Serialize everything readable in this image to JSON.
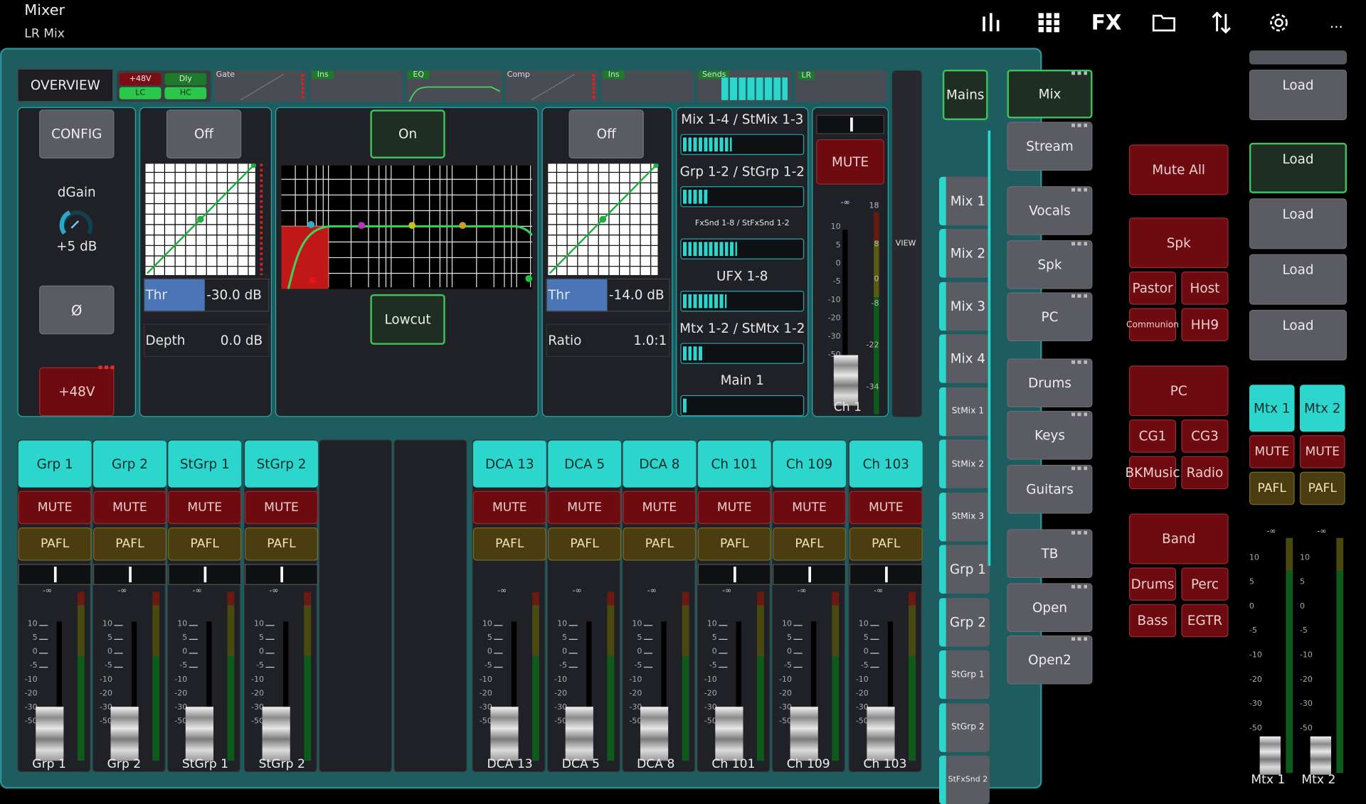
{
  "app": {
    "title": "Mixer",
    "subtitle": "LR Mix"
  },
  "toolbar": {
    "icons": [
      "meters-icon",
      "grid-icon",
      "fx-icon",
      "folder-icon",
      "transfer-icon",
      "settings-icon",
      "more-icon"
    ],
    "fx_label": "FX",
    "more_label": "..."
  },
  "overview": {
    "tab_label": "OVERVIEW",
    "badges": [
      "+48V",
      "Dly",
      "LC",
      "HC"
    ],
    "strip": [
      "Gate",
      "Ins",
      "EQ",
      "Comp",
      "Ins",
      "Sends",
      "LR"
    ]
  },
  "config": {
    "button": "CONFIG",
    "dgain_label": "dGain",
    "dgain_value": "+5 dB",
    "phase_label": "Ø",
    "phantom_label": "+48V"
  },
  "gate": {
    "state": "Off",
    "thr_label": "Thr",
    "thr_value": "-30.0 dB",
    "depth_label": "Depth",
    "depth_value": "0.0 dB"
  },
  "eq": {
    "state": "On",
    "lowcut_label": "Lowcut"
  },
  "comp": {
    "state": "Off",
    "thr_label": "Thr",
    "thr_value": "-14.0 dB",
    "ratio_label": "Ratio",
    "ratio_value": "1.0:1"
  },
  "sends": {
    "rows": [
      {
        "label": "Mix 1-4 / StMix 1-3",
        "level": 0.28
      },
      {
        "label": "Grp 1-2 / StGrp 1-2",
        "level": 0.14
      },
      {
        "label": "FxSnd 1-8 / StFxSnd 1-2",
        "level": 0.31
      },
      {
        "label": "UFX 1-8",
        "level": 0.25
      },
      {
        "label": "Mtx 1-2 / StMtx 1-2",
        "level": 0.12
      },
      {
        "label": "Main 1",
        "level": 0.02
      }
    ]
  },
  "channel": {
    "mute_label": "MUTE",
    "inf_label": "-∞",
    "name": "Ch 1",
    "meter_ticks": [
      "18",
      "8",
      "0",
      "-8",
      "-22",
      "-34"
    ],
    "view_label": "VIEW"
  },
  "fader_scale": [
    "10",
    "5",
    "0",
    "-5",
    "-10",
    "-20",
    "-30",
    "-50"
  ],
  "strips": [
    {
      "name": "Grp 1",
      "mute": "MUTE",
      "pafl": "PAFL",
      "inf": "-∞"
    },
    {
      "name": "Grp 2",
      "mute": "MUTE",
      "pafl": "PAFL",
      "inf": "-∞"
    },
    {
      "name": "StGrp 1",
      "mute": "MUTE",
      "pafl": "PAFL",
      "inf": "-∞"
    },
    {
      "name": "StGrp 2",
      "mute": "MUTE",
      "pafl": "PAFL",
      "inf": "-∞"
    },
    {
      "name": "DCA 13",
      "mute": "MUTE",
      "pafl": "PAFL",
      "inf": "-∞"
    },
    {
      "name": "DCA 5",
      "mute": "MUTE",
      "pafl": "PAFL",
      "inf": "-∞"
    },
    {
      "name": "DCA 8",
      "mute": "MUTE",
      "pafl": "PAFL",
      "inf": "-∞"
    },
    {
      "name": "Ch 101",
      "mute": "MUTE",
      "pafl": "PAFL",
      "inf": "-∞"
    },
    {
      "name": "Ch 109",
      "mute": "MUTE",
      "pafl": "PAFL",
      "inf": "-∞"
    },
    {
      "name": "Ch 103",
      "mute": "MUTE",
      "pafl": "PAFL",
      "inf": "-∞"
    }
  ],
  "mix_selector": [
    "Mains",
    "Mix 1",
    "Mix 2",
    "Mix 3",
    "Mix 4",
    "StMix 1",
    "StMix 2",
    "StMix 3",
    "Grp 1",
    "Grp 2",
    "StGrp 1",
    "StGrp 2",
    "StFxSnd 2"
  ],
  "layers": [
    "Mix",
    "Stream",
    "Vocals",
    "Spk",
    "PC",
    "Drums",
    "Keys",
    "Guitars",
    "TB",
    "Open",
    "Open2"
  ],
  "mute_groups": {
    "mute_all": "Mute All",
    "spk": "Spk",
    "spk_items": [
      "Pastor",
      "Host",
      "Communion",
      "HH9"
    ],
    "pc": "PC",
    "pc_items": [
      "CG1",
      "CG3",
      "BKMusic",
      "Radio"
    ],
    "band": "Band",
    "band_items": [
      "Drums",
      "Perc",
      "Bass",
      "EGTR"
    ]
  },
  "scenes": {
    "load_labels": [
      "Load",
      "Load",
      "Load",
      "Load",
      "Load"
    ]
  },
  "matrix": [
    {
      "name": "Mtx 1",
      "mute": "MUTE",
      "pafl": "PAFL",
      "inf": "-∞"
    },
    {
      "name": "Mtx 2",
      "mute": "MUTE",
      "pafl": "PAFL",
      "inf": "-∞"
    }
  ]
}
